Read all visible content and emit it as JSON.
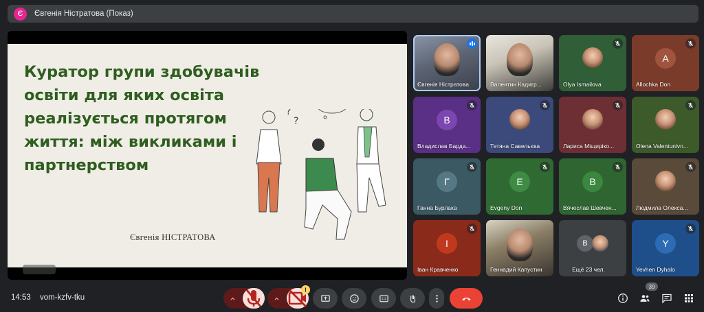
{
  "presenter": {
    "avatar_initial": "Є",
    "title": "Євгенія Ністратова (Показ)"
  },
  "slide": {
    "title": "Куратор групи здобувачів освіти для яких освіта реалізується протягом життя: між викликами і партнерством",
    "author": "Євгенія НІСТРАТОВА",
    "title_color": "#2e5e1f"
  },
  "tiles": [
    {
      "name": "Євгенія Ністратова",
      "kind": "video",
      "mic": "speaking"
    },
    {
      "name": "Валентин Кадигр...",
      "kind": "video",
      "mic": "none"
    },
    {
      "name": "Olya Ismailova",
      "kind": "photo",
      "mic": "muted",
      "bg": "#2f5e37"
    },
    {
      "name": "Allochka Don",
      "kind": "initial",
      "initial": "A",
      "mic": "muted",
      "bg": "#7a3b2a",
      "circle": "#a0543d"
    },
    {
      "name": "Владислав Барда...",
      "kind": "initial",
      "initial": "В",
      "mic": "muted",
      "bg": "#5a2f86",
      "circle": "#7b46b0"
    },
    {
      "name": "Тетяна Савельєва",
      "kind": "photo",
      "mic": "muted",
      "bg": "#3b4a7a"
    },
    {
      "name": "Лариса Міщиріко...",
      "kind": "photo",
      "mic": "muted",
      "bg": "#6e2f34"
    },
    {
      "name": "Olena Valentunivn...",
      "kind": "photo",
      "mic": "muted",
      "bg": "#3c5a2a"
    },
    {
      "name": "Ганна Бурлака",
      "kind": "initial",
      "initial": "Г",
      "mic": "muted",
      "bg": "#3a5963",
      "circle": "#557984"
    },
    {
      "name": "Evgeny Don",
      "kind": "initial",
      "initial": "E",
      "mic": "muted",
      "bg": "#2f6a32",
      "circle": "#3f8b43"
    },
    {
      "name": "Вячеслав Шевчен...",
      "kind": "initial",
      "initial": "В",
      "mic": "muted",
      "bg": "#2f6530",
      "circle": "#3c8740"
    },
    {
      "name": "Людмила Олекса...",
      "kind": "photo",
      "mic": "muted",
      "bg": "#5a4a3a"
    },
    {
      "name": "Іван Кравченко",
      "kind": "initial",
      "initial": "І",
      "mic": "muted",
      "bg": "#8a2a1a",
      "circle": "#c0391f"
    },
    {
      "name": "Геннадий Капустин",
      "kind": "video",
      "mic": "none"
    },
    {
      "name": "Ещё 23 чел.",
      "kind": "more",
      "initial": "В",
      "mic": "none",
      "bg": "#3c4043"
    },
    {
      "name": "Yevhen Dyhalo",
      "kind": "initial",
      "initial": "Y",
      "mic": "muted",
      "bg": "#1e4f8a",
      "circle": "#2d6bb4"
    }
  ],
  "bottom": {
    "clock": "14:53",
    "meeting_code": "vom-kzfv-tku",
    "participants_count": "39",
    "warning_mark": "!"
  },
  "colors": {
    "end_call": "#ea4335",
    "muted_btn": "#f9dedc",
    "muted_pair": "#5c1a1a",
    "speaking": "#1a73e8"
  }
}
